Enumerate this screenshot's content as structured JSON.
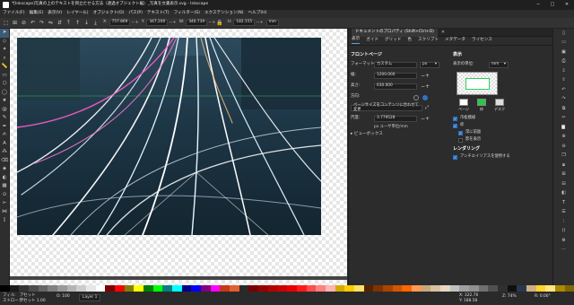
{
  "window": {
    "title": "*[Inkscape]写真の上のテキストを目立たせる方法（透過オブジェクト編）_写真を文書表示.svg - Inkscape",
    "controls": [
      "─",
      "□",
      "✕"
    ]
  },
  "menubar": [
    "ファイル(F)",
    "編集(E)",
    "表示(V)",
    "レイヤー(L)",
    "オブジェクト(O)",
    "パス(P)",
    "テキスト(T)",
    "フィルター(S)",
    "エクステンション(N)",
    "ヘルプ(H)"
  ],
  "toolbar": {
    "x_label": "X:",
    "x_value": "757.869",
    "y_label": "Y:",
    "y_value": "347.200",
    "w_label": "W:",
    "w_value": "346.739",
    "h_label": "H:",
    "h_value": "182.155",
    "unit": "mm"
  },
  "dialog": {
    "title": "ドキュメントのプロパティ (Shift+Ctrl+D)",
    "close": "✕",
    "tabs": [
      "表示",
      "ガイド",
      "グリッド",
      "色",
      "スクリプト",
      "メタデータ",
      "ライセンス"
    ],
    "front_page": {
      "heading": "フロントページ",
      "format_label": "フォーマット:",
      "format_value": "カスタム",
      "format_unit": "px",
      "width_label": "幅:",
      "width_value": "1200.000",
      "height_label": "高さ:",
      "height_value": "630.000",
      "orientation_label": "方向:",
      "resize_label": "ページサイズをコンテンツに合わせて変更",
      "scale_label": "尺度:",
      "scale_value": "3.779528",
      "scale_note": "px ユーザ単位/mm",
      "viewbox_label": "ビューボックス"
    },
    "display": {
      "heading": "表示",
      "units_label": "表示の単位:",
      "units_value": "mm",
      "page_label": "ページ",
      "border_label": "枠",
      "desk_label": "デスク",
      "page_color": "#ffffff",
      "border_color": "#22cc44",
      "desk_color": "#dddddd",
      "checkboxes": [
        {
          "label": "市松模様",
          "checked": true
        },
        {
          "label": "枠",
          "checked": true
        },
        {
          "label": "常に前面",
          "checked": true
        },
        {
          "label": "影を表示",
          "checked": false
        }
      ],
      "rendering_heading": "レンダリング",
      "antialias_label": "アンチエイリアスを使用する",
      "antialias_checked": true
    }
  },
  "status": {
    "fill_label": "フィル:",
    "fill_value": "アセット",
    "stroke_label": "ストローク:",
    "stroke_value": "アセット 1.00",
    "opacity_label": "O:",
    "opacity_value": "100",
    "layer": "Layer 1",
    "message": "",
    "x_label": "X:",
    "x_value": "322.76",
    "y_label": "Y:",
    "y_value": "188.58",
    "zoom_label": "Z:",
    "zoom_value": "74%",
    "rot_label": "R:",
    "rot_value": "0.00°"
  },
  "palette": [
    "#000000",
    "#1a1a1a",
    "#333333",
    "#4d4d4d",
    "#666666",
    "#808080",
    "#999999",
    "#b3b3b3",
    "#cccccc",
    "#e6e6e6",
    "#ffffff",
    "#800000",
    "#ff0000",
    "#808000",
    "#ffff00",
    "#008000",
    "#00ff00",
    "#008080",
    "#00ffff",
    "#000080",
    "#0000ff",
    "#800080",
    "#ff00ff",
    "#c8371a",
    "#e06030",
    "#2a2a2a",
    "#7a0000",
    "#990000",
    "#b30000",
    "#cc0000",
    "#e60000",
    "#ff1a1a",
    "#ff4d4d",
    "#ff8080",
    "#ffb3b3",
    "#d4aa00",
    "#ffcc00",
    "#ffe066",
    "#552200",
    "#803300",
    "#aa4400",
    "#d45500",
    "#ff6600",
    "#ff9955",
    "#c8a87a",
    "#d8c0a0",
    "#e8d8c0",
    "#c0c0c0",
    "#a0a0a0",
    "#909090",
    "#707070",
    "#505050",
    "#303030",
    "#101010",
    "#283850",
    "#d0b080",
    "#ffd42a",
    "#ffe680",
    "#aa8800",
    "#806600"
  ]
}
